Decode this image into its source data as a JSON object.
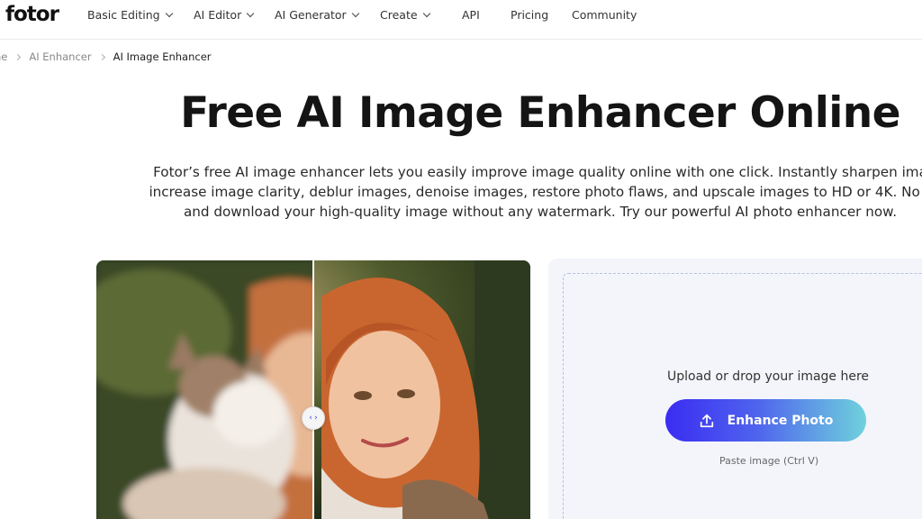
{
  "brand": {
    "logo_text": "fotor"
  },
  "nav": {
    "items": [
      {
        "label": "Basic Editing",
        "has_dropdown": true
      },
      {
        "label": "AI Editor",
        "has_dropdown": true
      },
      {
        "label": "AI Generator",
        "has_dropdown": true
      },
      {
        "label": "Create",
        "has_dropdown": true
      },
      {
        "label": "API",
        "has_dropdown": false
      },
      {
        "label": "Pricing",
        "has_dropdown": false
      },
      {
        "label": "Community",
        "has_dropdown": false
      }
    ]
  },
  "breadcrumb": {
    "home": "ne",
    "parent": "AI Enhancer",
    "current": "AI Image Enhancer"
  },
  "hero": {
    "title": "Free AI Image Enhancer Online",
    "description_lines": [
      "Fotor’s free AI image enhancer lets you easily improve image quality online with one click. Instantly sharpen ima",
      "increase image clarity, deblur images, denoise images, restore photo flaws, and upscale images to HD or 4K. No s",
      "and download your high-quality image without any watermark. Try our powerful AI photo enhancer now."
    ]
  },
  "upload": {
    "prompt": "Upload or drop your image here",
    "button_label": "Enhance Photo",
    "paste_hint": "Paste image (Ctrl V)"
  },
  "icons": {
    "compare_handle": "left-right-arrows-icon",
    "upload": "upload-icon",
    "chevron": "chevron-down-icon",
    "breadcrumb_sep": "chevron-right-icon"
  },
  "colors": {
    "button_gradient_start": "#3a2cf2",
    "button_gradient_end": "#6fd2dc",
    "panel_bg": "#f3f5fb"
  }
}
